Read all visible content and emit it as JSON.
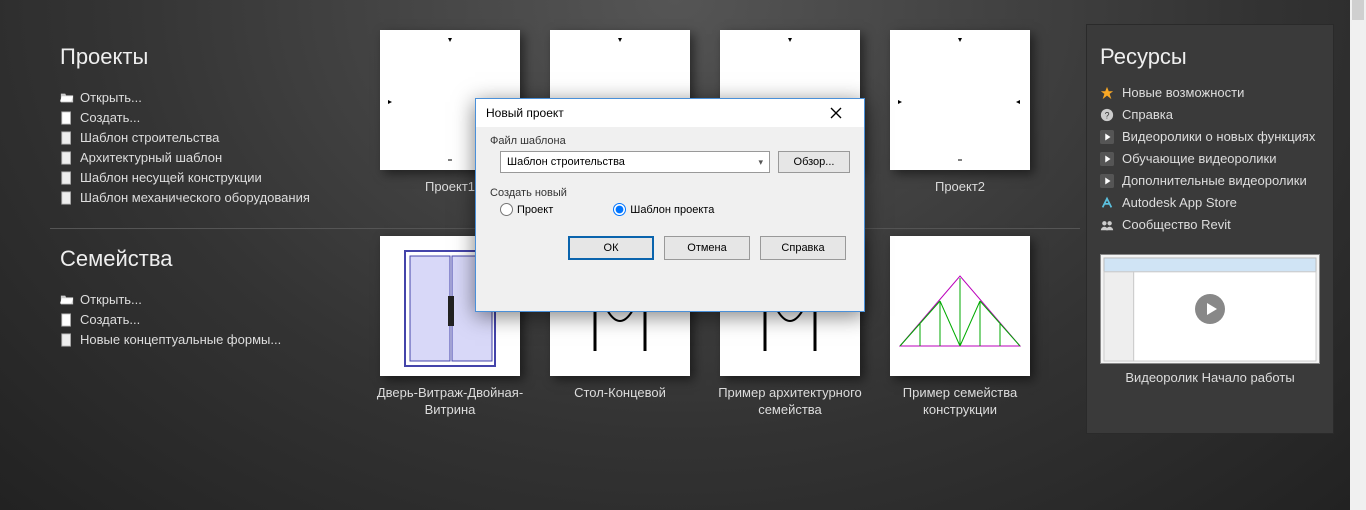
{
  "projects": {
    "heading": "Проекты",
    "links": {
      "open": "Открыть...",
      "create": "Создать...",
      "t_construction": "Шаблон строительства",
      "t_arch": "Архитектурный шаблон",
      "t_struct": "Шаблон несущей конструкции",
      "t_mech": "Шаблон механического оборудования"
    },
    "cards": [
      {
        "label": "Проект1"
      },
      {
        "label": ""
      },
      {
        "label": ""
      },
      {
        "label": "Проект2"
      }
    ]
  },
  "families": {
    "heading": "Семейства",
    "links": {
      "open": "Открыть...",
      "create": "Создать...",
      "conceptual": "Новые концептуальные формы..."
    },
    "cards": [
      {
        "label": "Дверь-Витраж-Двойная-Витрина"
      },
      {
        "label": "Стол-Концевой"
      },
      {
        "label": "Пример архитектурного семейства"
      },
      {
        "label": "Пример семейства конструкции"
      }
    ]
  },
  "resources": {
    "heading": "Ресурсы",
    "items": {
      "whatsnew": "Новые возможности",
      "help": "Справка",
      "videos_new": "Видеоролики о новых функциях",
      "videos_learn": "Обучающие видеоролики",
      "videos_more": "Дополнительные видеоролики",
      "appstore": "Autodesk App Store",
      "community": "Сообщество Revit"
    },
    "video_caption": "Видеоролик Начало работы"
  },
  "dialog": {
    "title": "Новый проект",
    "group_template": "Файл шаблона",
    "combo_value": "Шаблон строительства",
    "browse": "Обзор...",
    "group_create": "Создать новый",
    "radio_project": "Проект",
    "radio_template": "Шаблон проекта",
    "ok": "ОК",
    "cancel": "Отмена",
    "help": "Справка"
  }
}
